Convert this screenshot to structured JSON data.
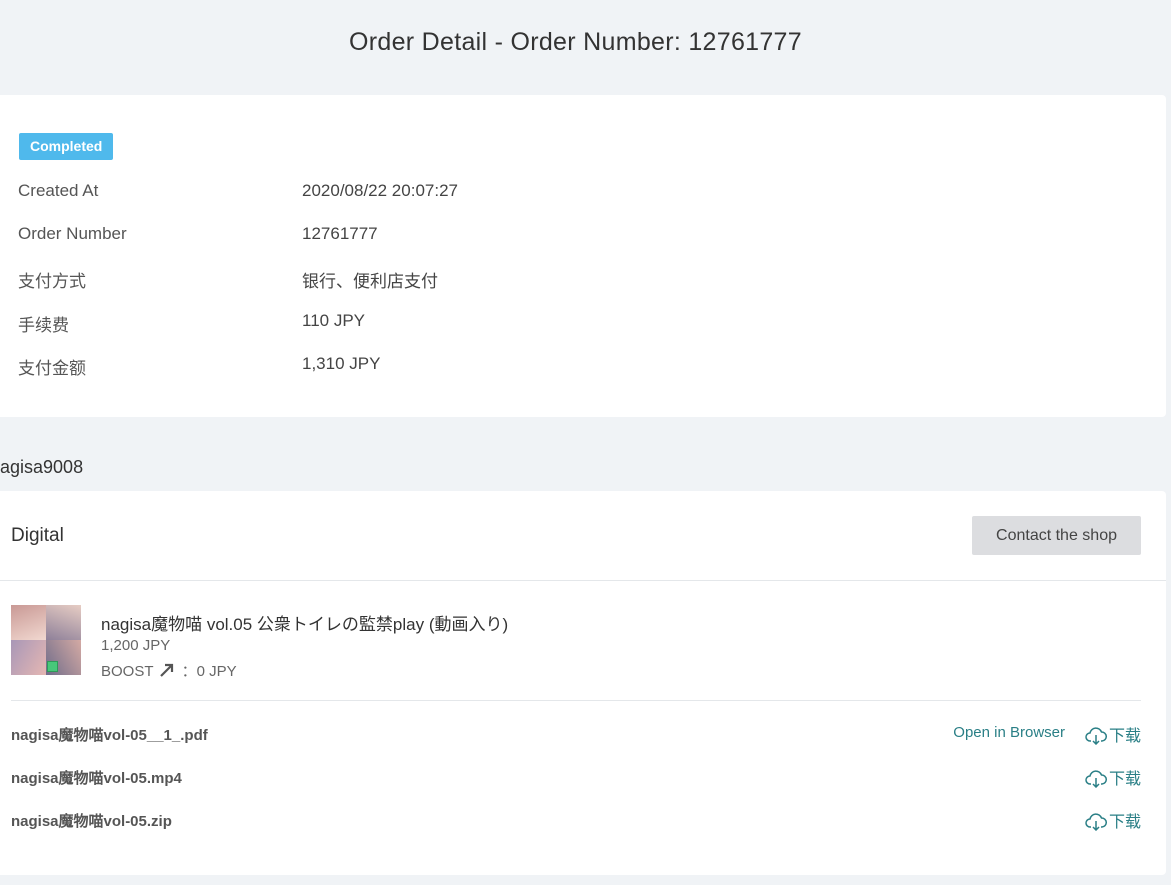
{
  "page": {
    "title": "Order Detail - Order Number: 12761777"
  },
  "order_info": {
    "status": "Completed",
    "rows": [
      {
        "label": "Created At",
        "value": "2020/08/22 20:07:27"
      },
      {
        "label": "Order Number",
        "value": "12761777"
      },
      {
        "label": "支付方式",
        "value": "银行、便利店支付"
      },
      {
        "label": "手续费",
        "value": "110 JPY"
      },
      {
        "label": "支付金额",
        "value": "1,310 JPY"
      }
    ]
  },
  "shop": {
    "name": "agisa9008",
    "type_label": "Digital",
    "contact_label": "Contact the shop"
  },
  "product": {
    "title": "nagisa魔物喵 vol.05 公衆トイレの監禁play (動画入り)",
    "price": "1,200 JPY",
    "boost_label": "BOOST",
    "boost_value": "：0 JPY"
  },
  "files": [
    {
      "name": "nagisa魔物喵vol-05__1_.pdf",
      "open_label": "Open in Browser",
      "download_label": "下载"
    },
    {
      "name": "nagisa魔物喵vol-05.mp4",
      "download_label": "下载"
    },
    {
      "name": "nagisa魔物喵vol-05.zip",
      "download_label": "下载"
    }
  ],
  "colors": {
    "badge": "#4fb9ec",
    "link": "#2a7f86",
    "background": "#f0f3f6"
  }
}
